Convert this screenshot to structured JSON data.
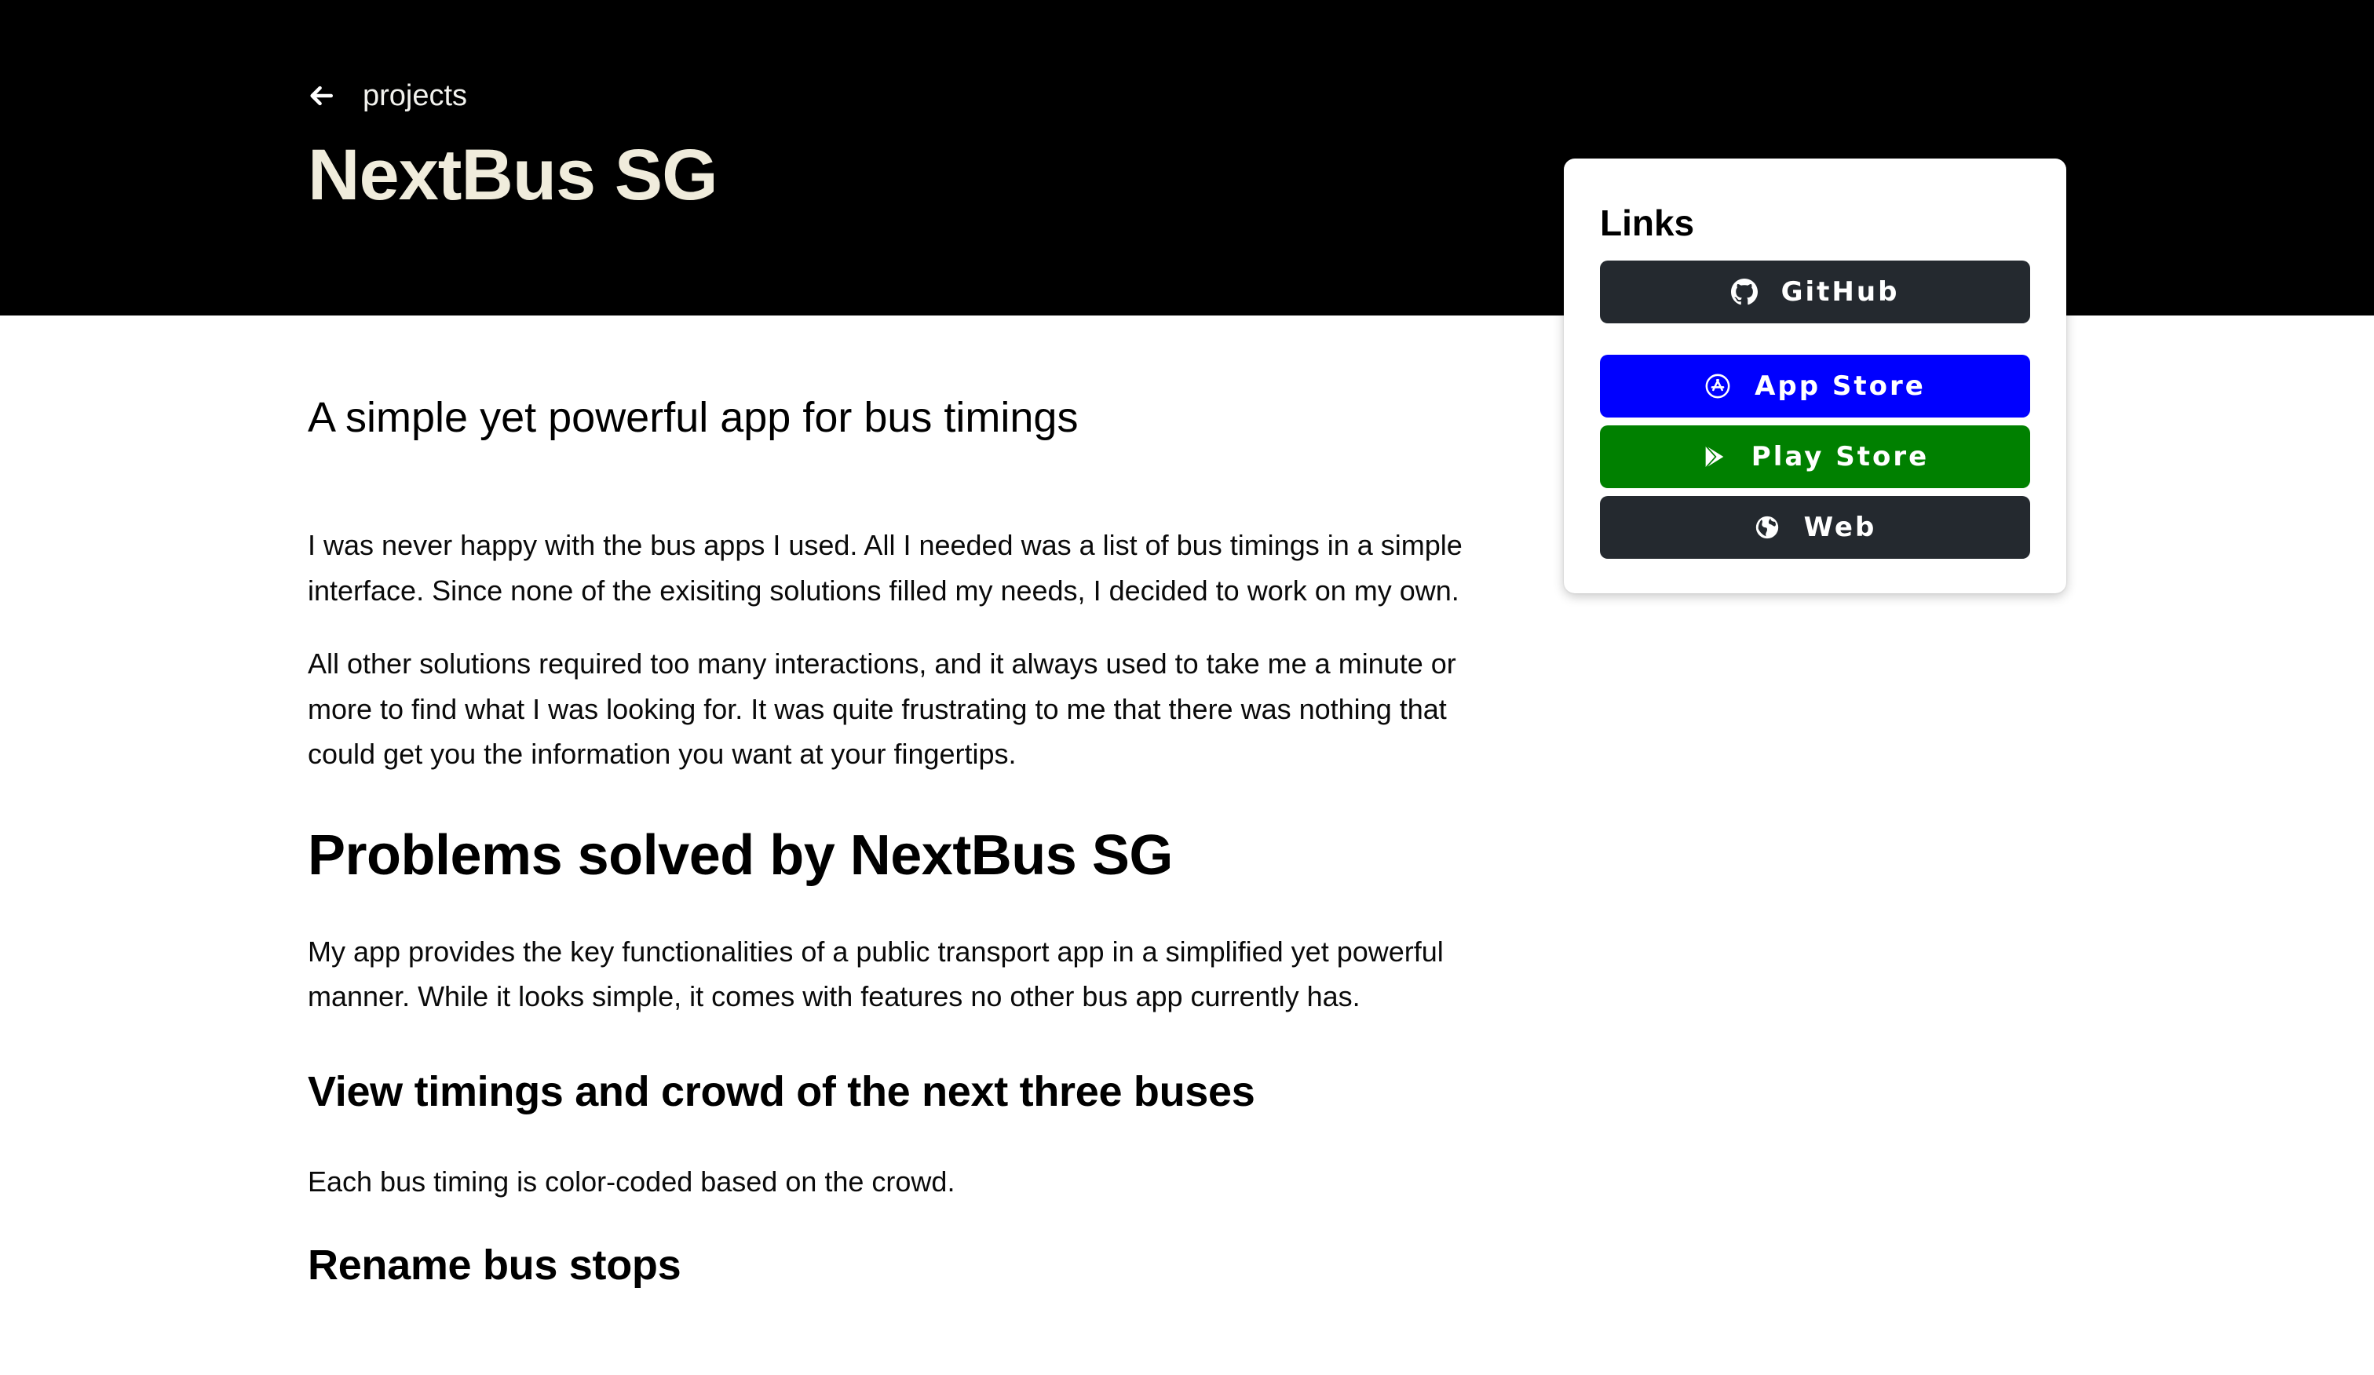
{
  "header": {
    "back_label": "projects",
    "title": "NextBus SG",
    "background": "#000000"
  },
  "links_card": {
    "title": "Links",
    "buttons": [
      {
        "label": "GitHub",
        "icon": "github-icon",
        "color": "#24292f"
      },
      {
        "label": "App Store",
        "icon": "app-store-icon",
        "color": "#0000ff"
      },
      {
        "label": "Play Store",
        "icon": "play-store-icon",
        "color": "#008000"
      },
      {
        "label": "Web",
        "icon": "globe-icon",
        "color": "#24292f"
      }
    ]
  },
  "content": {
    "tagline": "A simple yet powerful app for bus timings",
    "intro": [
      "I was never happy with the bus apps I used. All I needed was a list of bus timings in a simple interface. Since none of the exisiting solutions filled my needs, I decided to work on my own.",
      "All other solutions required too many interactions, and it always used to take me a minute or more to find what I was looking for. It was quite frustrating to me that there was nothing that could get you the information you want at your fingertips."
    ],
    "section_heading": "Problems solved by NextBus SG",
    "section_para": "My app provides the key functionalities of a public transport app in a simplified yet powerful manner. While it looks simple, it comes with features no other bus app currently has.",
    "feature1_heading": "View timings and crowd of the next three buses",
    "feature1_para": "Each bus timing is color-coded based on the crowd.",
    "feature2_heading": "Rename bus stops"
  }
}
